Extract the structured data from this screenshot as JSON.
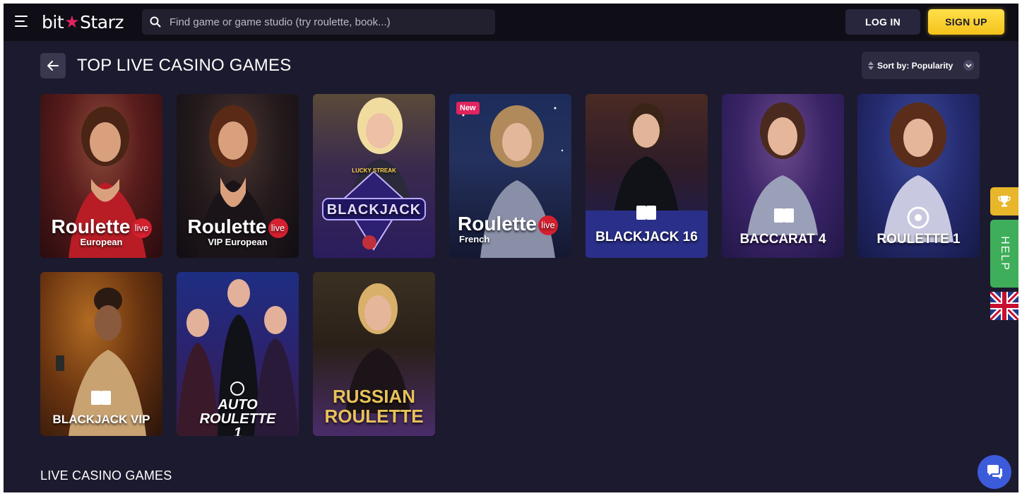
{
  "header": {
    "logo_left": "bit",
    "logo_star": "★",
    "logo_right": "Starz",
    "search_placeholder": "Find game or game studio (try roulette, book...)",
    "login_label": "LOG IN",
    "signup_label": "SIGN UP"
  },
  "section": {
    "title": "TOP LIVE CASINO GAMES",
    "sort_label": "Sort by: Popularity"
  },
  "games": [
    {
      "title": "Roulette",
      "sub": "European",
      "live": "live",
      "theme": "red"
    },
    {
      "title": "Roulette",
      "sub": "VIP European",
      "live": "live",
      "theme": "dark"
    },
    {
      "title": "BLACKJACK",
      "sub": "LUCKY STREAK",
      "theme": "purple"
    },
    {
      "title": "Roulette",
      "sub": "French",
      "live": "live",
      "badge": "New",
      "theme": "blue"
    },
    {
      "title": "BLACKJACK 16",
      "theme": "navy"
    },
    {
      "title": "BACCARAT 4",
      "theme": "violet"
    },
    {
      "title": "ROULETTE 1",
      "theme": "indigo"
    },
    {
      "title": "BLACKJACK VIP",
      "theme": "gold"
    },
    {
      "title": "AUTO ROULETTE 1",
      "theme": "bluepurple"
    },
    {
      "title": "RUSSIAN ROULETTE",
      "theme": "brown"
    }
  ],
  "bottom_section": {
    "title": "LIVE CASINO GAMES"
  },
  "side": {
    "help_label": "HELP"
  },
  "colors": {
    "background": "#1c1a2e",
    "topbar": "#0f0e16",
    "signup": "#f4c21b",
    "accent_red": "#e0245e",
    "help_green": "#3fae5a",
    "chat_blue": "#3b5bdb"
  }
}
